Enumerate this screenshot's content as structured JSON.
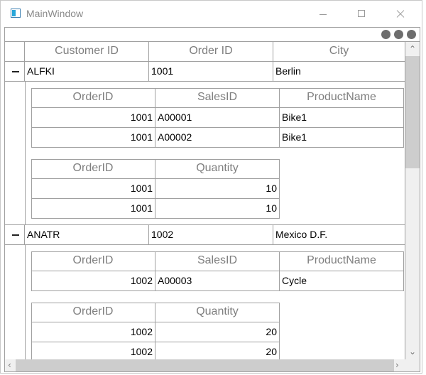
{
  "window": {
    "title": "MainWindow"
  },
  "master_columns": [
    "Customer ID",
    "Order ID",
    "City"
  ],
  "records": [
    {
      "customer_id": "ALFKI",
      "order_id": "1001",
      "city": "Berlin",
      "sales": {
        "columns": [
          "OrderID",
          "SalesID",
          "ProductName"
        ],
        "rows": [
          [
            "1001",
            "A00001",
            "Bike1"
          ],
          [
            "1001",
            "A00002",
            "Bike1"
          ]
        ]
      },
      "quantity": {
        "columns": [
          "OrderID",
          "Quantity"
        ],
        "rows": [
          [
            "1001",
            "10"
          ],
          [
            "1001",
            "10"
          ]
        ]
      }
    },
    {
      "customer_id": "ANATR",
      "order_id": "1002",
      "city": "Mexico D.F.",
      "sales": {
        "columns": [
          "OrderID",
          "SalesID",
          "ProductName"
        ],
        "rows": [
          [
            "1002",
            "A00003",
            "Cycle"
          ]
        ]
      },
      "quantity": {
        "columns": [
          "OrderID",
          "Quantity"
        ],
        "rows": [
          [
            "1002",
            "20"
          ],
          [
            "1002",
            "20"
          ]
        ]
      }
    }
  ]
}
